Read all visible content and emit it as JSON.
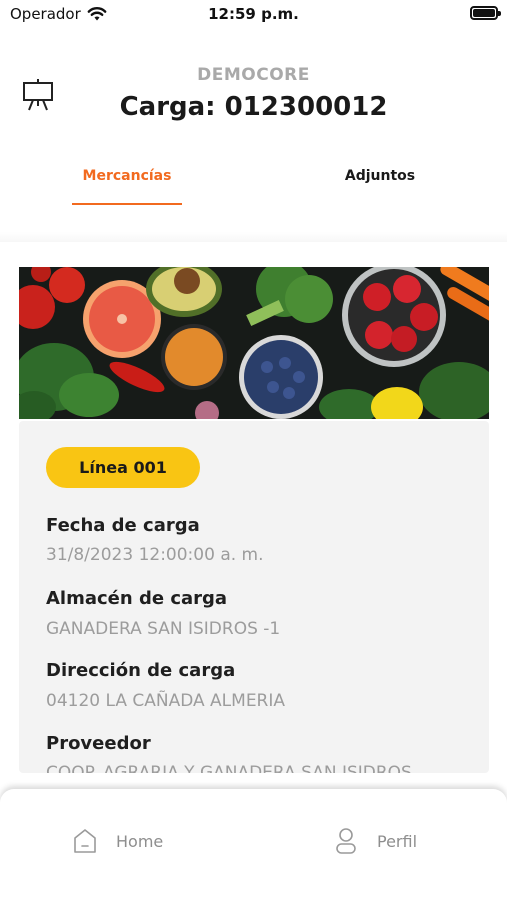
{
  "status_bar": {
    "carrier": "Operador",
    "time": "12:59 p.m."
  },
  "header": {
    "company": "DEMOCORE",
    "title": "Carga: 012300012",
    "board_icon": "presentation-board-icon"
  },
  "tabs": [
    {
      "label": "Mercancías",
      "active": true
    },
    {
      "label": "Adjuntos",
      "active": false
    }
  ],
  "banner": {
    "description_icon": "vegetables-banner-image"
  },
  "card": {
    "badge": "Línea 001",
    "fields": [
      {
        "label": "Fecha de carga",
        "value": "31/8/2023 12:00:00 a. m."
      },
      {
        "label": "Almacén de carga",
        "value": " GANADERA SAN ISIDROS -1"
      },
      {
        "label": "Dirección de carga",
        "value": "04120 LA CAÑADA ALMERIA"
      },
      {
        "label": "Proveedor",
        "value": "COOP. AGRARIA Y GANADERA SAN ISIDROS"
      }
    ]
  },
  "bottom_nav": [
    {
      "label": "Home",
      "icon": "home-icon"
    },
    {
      "label": "Perfil",
      "icon": "user-icon"
    }
  ],
  "colors": {
    "accent": "#f26a1f",
    "badge": "#f9c513",
    "card_bg": "#f3f3f3",
    "muted_text": "#9c9c9c"
  }
}
